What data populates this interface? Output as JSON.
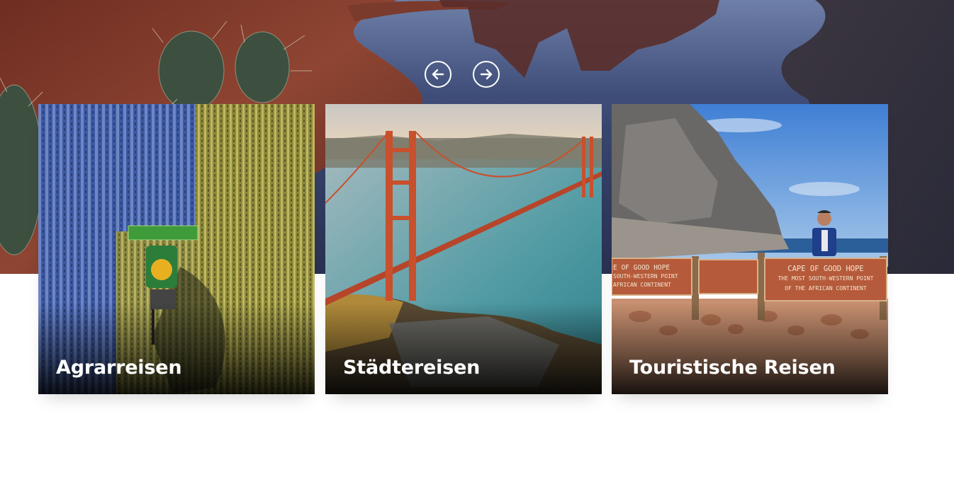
{
  "carousel": {
    "prev_icon": "arrow-left-icon",
    "next_icon": "arrow-right-icon"
  },
  "cards": [
    {
      "label": "Agrarreisen",
      "image": "aerial-combine-harvester-field"
    },
    {
      "label": "Städtereisen",
      "image": "golden-gate-bridge"
    },
    {
      "label": "Touristische Reisen",
      "image": "cape-of-good-hope-sign"
    }
  ],
  "signs": {
    "left_line1": "E OF GOOD HOPE",
    "left_line2": "SOUTH-WESTERN POINT",
    "left_line3": "AFRICAN CONTINENT",
    "right_line1": "CAPE OF GOOD HOPE",
    "right_line2": "THE MOST SOUTH-WESTERN POINT",
    "right_line3": "OF THE AFRICAN CONTINENT"
  },
  "colors": {
    "white": "#ffffff",
    "hero_water": "#2c3a5e",
    "rock_red": "#8a3b2a"
  }
}
